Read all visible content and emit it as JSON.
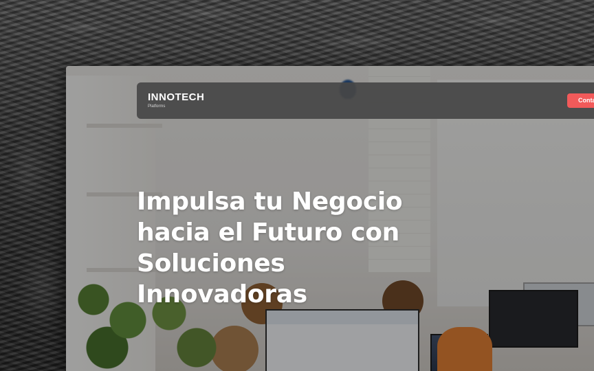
{
  "brand": {
    "name": "INNOTECH",
    "subtitle": "Platforms"
  },
  "nav": {
    "contact_label": "Conta"
  },
  "hero": {
    "title": "Impulsa tu Negocio hacia el Futuro con Soluciones Innovadoras"
  },
  "colors": {
    "accent": "#f25a5a",
    "navbar_bg": "#464646",
    "hero_text": "#ffffff"
  }
}
